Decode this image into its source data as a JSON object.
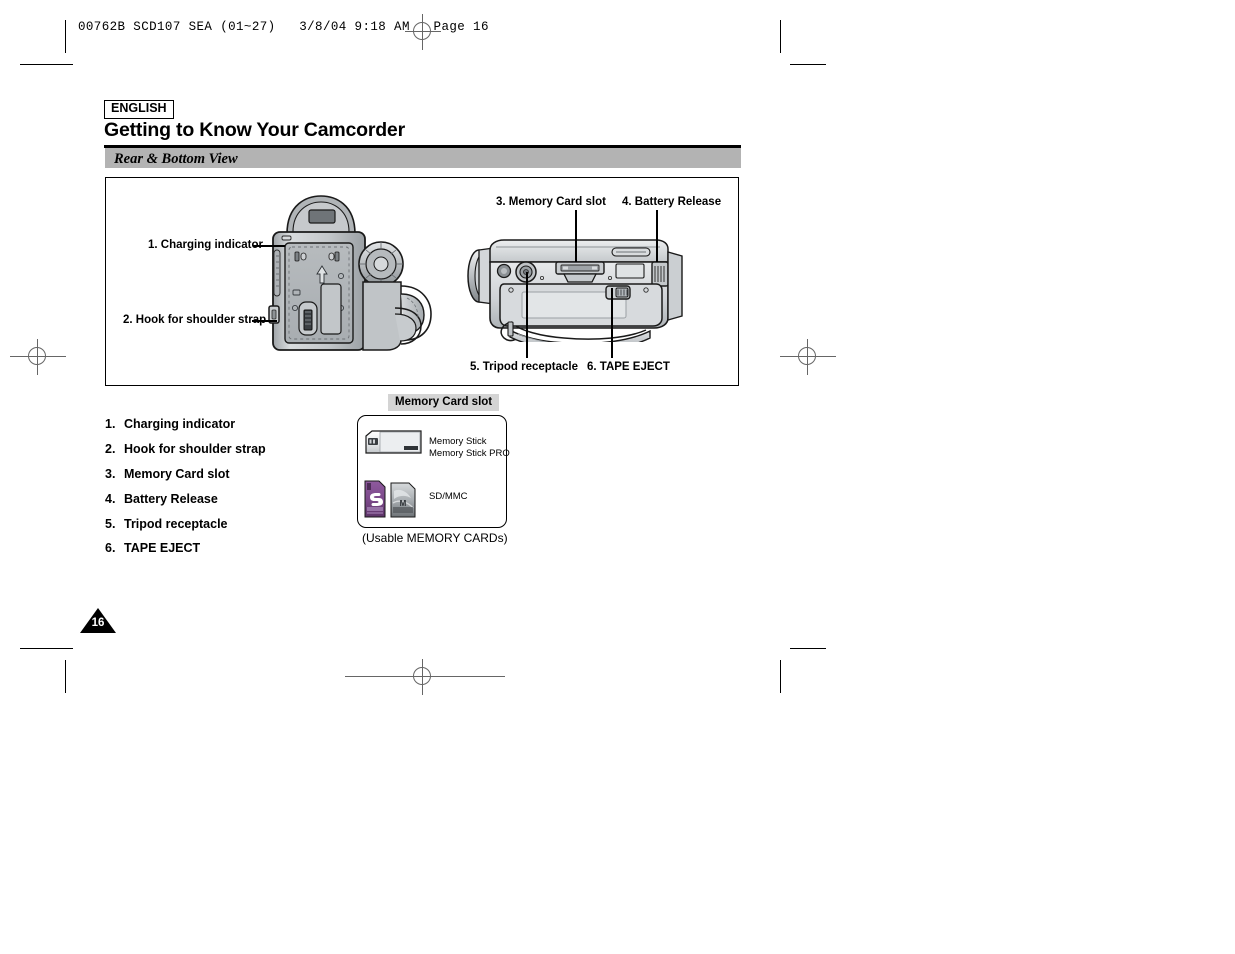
{
  "print_slug": "00762B SCD107 SEA (01~27)   3/8/04 9:18 AM   Page 16",
  "header": {
    "language_badge": "ENGLISH",
    "title": "Getting to Know Your Camcorder",
    "section": "Rear & Bottom View"
  },
  "figure": {
    "rear_callouts": [
      {
        "label": "1. Charging indicator"
      },
      {
        "label": "2. Hook for shoulder strap"
      }
    ],
    "bottom_callouts_top": [
      {
        "label": "3. Memory Card slot"
      },
      {
        "label": "4. Battery Release"
      }
    ],
    "bottom_callouts_bottom": [
      {
        "label": "5. Tripod receptacle"
      },
      {
        "label": "6. TAPE EJECT"
      }
    ]
  },
  "parts_list": [
    {
      "num": "1.",
      "label": "Charging indicator"
    },
    {
      "num": "2.",
      "label": "Hook for shoulder strap"
    },
    {
      "num": "3.",
      "label": "Memory Card slot"
    },
    {
      "num": "4.",
      "label": "Battery Release"
    },
    {
      "num": "5.",
      "label": "Tripod receptacle"
    },
    {
      "num": "6.",
      "label": "TAPE EJECT"
    }
  ],
  "memory_card_panel": {
    "badge": "Memory Card slot",
    "caption": "(Usable MEMORY CARDs)",
    "entries": [
      {
        "line1": "Memory Stick",
        "line2": "Memory Stick PRO"
      },
      {
        "line1": "SD/MMC",
        "line2": ""
      }
    ]
  },
  "page_number": "16",
  "colors": {
    "section_bar": "#b3b3b3",
    "badge_gray": "#d4d4d4",
    "sd_purple": "#7d4a8c",
    "body_gray": "#c9ccce"
  }
}
